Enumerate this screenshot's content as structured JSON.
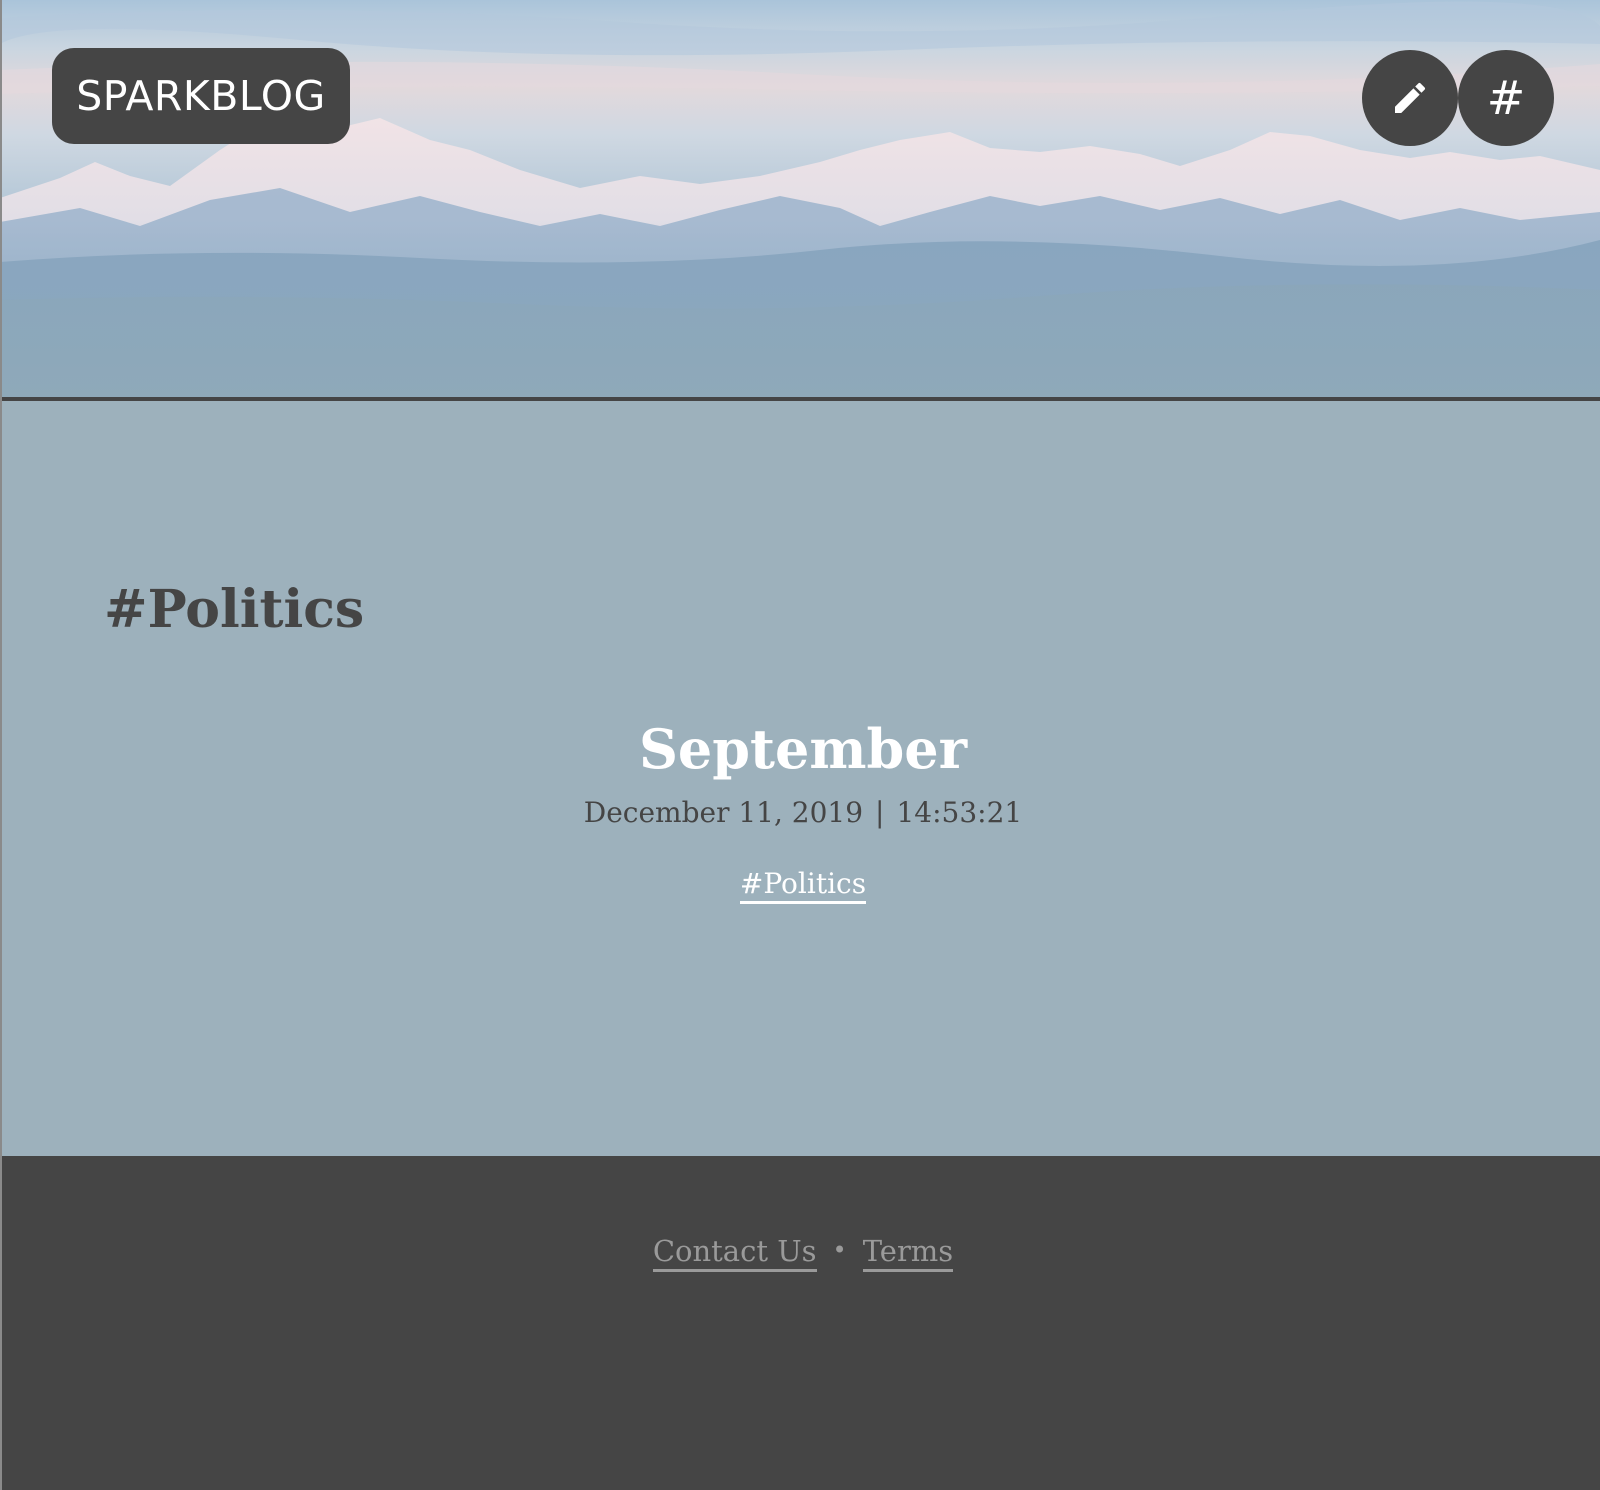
{
  "header": {
    "brand": "SPARKBLOG",
    "buttons": [
      {
        "icon": "pencil-icon"
      },
      {
        "icon": "hash-icon",
        "glyph": "#"
      }
    ]
  },
  "main": {
    "tag_heading": "#Politics",
    "posts": [
      {
        "title": "September",
        "date": "December 11, 2019",
        "separator": "|",
        "time": "14:53:21",
        "tag": "#Politics"
      }
    ]
  },
  "footer": {
    "links": [
      "Contact Us",
      "Terms"
    ],
    "separator": "•"
  },
  "colors": {
    "dark": "#454545",
    "main_bg": "#9db1bc",
    "footer_link": "#9a9a9a",
    "white": "#ffffff"
  }
}
